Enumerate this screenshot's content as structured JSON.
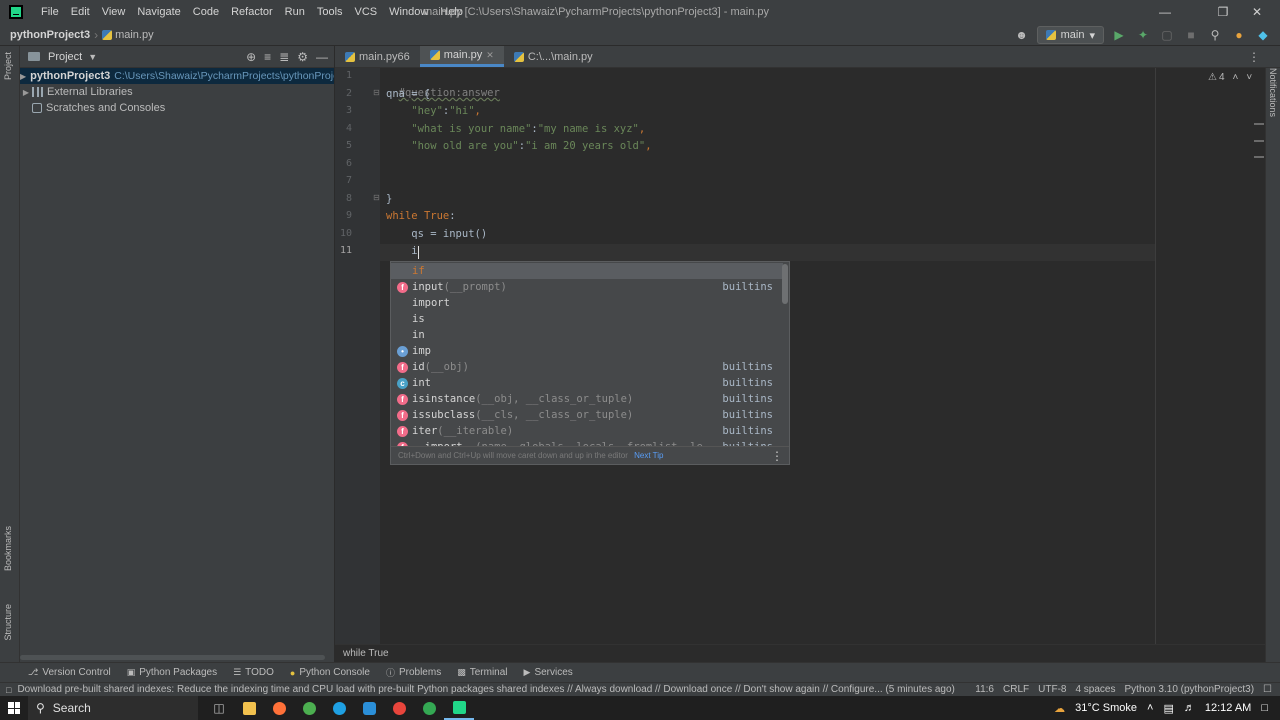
{
  "menu": [
    "File",
    "Edit",
    "View",
    "Navigate",
    "Code",
    "Refactor",
    "Run",
    "Tools",
    "VCS",
    "Window",
    "Help"
  ],
  "window_title": "main.py [C:\\Users\\Shawaiz\\PycharmProjects\\pythonProject3] - main.py",
  "nav": {
    "project": "pythonProject3",
    "file": "main.py",
    "run_config": "main"
  },
  "project_panel": {
    "title": "Project",
    "tree": [
      {
        "label": "pythonProject3",
        "path": "C:\\Users\\Shawaiz\\PycharmProjects\\pythonProject"
      },
      {
        "label": "External Libraries"
      },
      {
        "label": "Scratches and Consoles"
      }
    ]
  },
  "tabs": [
    "main.py66",
    "main.py",
    "C:\\...\\main.py"
  ],
  "line_numbers": [
    "1",
    "2",
    "3",
    "4",
    "5",
    "6",
    "7",
    "8",
    "9",
    "10",
    "11"
  ],
  "code": {
    "l1": "#question:answer",
    "l2a": "qna",
    "l2b": " = {",
    "l3a": "    \"hey\"",
    "l3b": ":",
    "l3c": "\"hi\"",
    "l3d": ",",
    "l4a": "    \"what is your name\"",
    "l4b": ":",
    "l4c": "\"my name is xyz\"",
    "l4d": ",",
    "l5a": "    \"how old are you\"",
    "l5b": ":",
    "l5c": "\"i am 20 years old\"",
    "l5d": ",",
    "l8": "}",
    "l9a": "while",
    "l9b": " ",
    "l9c": "True",
    "l9d": ":",
    "l10a": "    qs = ",
    "l10b": "input",
    "l10c": "()",
    "l11": "    i"
  },
  "inspection": {
    "warnings": "4"
  },
  "completion": {
    "items": [
      {
        "name": "if",
        "params": "",
        "source": "",
        "icon": "none"
      },
      {
        "name": "input",
        "params": "(__prompt)",
        "source": "builtins",
        "icon": "f"
      },
      {
        "name": "import",
        "params": "",
        "source": "",
        "icon": "none"
      },
      {
        "name": "is",
        "params": "",
        "source": "",
        "icon": "none"
      },
      {
        "name": "in",
        "params": "",
        "source": "",
        "icon": "none"
      },
      {
        "name": "imp",
        "params": "",
        "source": "",
        "icon": "m"
      },
      {
        "name": "id",
        "params": "(__obj)",
        "source": "builtins",
        "icon": "f"
      },
      {
        "name": "int",
        "params": "",
        "source": "builtins",
        "icon": "c"
      },
      {
        "name": "isinstance",
        "params": "(__obj, __class_or_tuple)",
        "source": "builtins",
        "icon": "f"
      },
      {
        "name": "issubclass",
        "params": "(__cls, __class_or_tuple)",
        "source": "builtins",
        "icon": "f"
      },
      {
        "name": "iter",
        "params": "(__iterable)",
        "source": "builtins",
        "icon": "f"
      },
      {
        "name": "__import__",
        "params": "(name, globals, locals, fromlist, le",
        "source": "builtins",
        "icon": "f"
      }
    ],
    "hint": "Ctrl+Down and Ctrl+Up will move caret down and up in the editor",
    "next_tip": "Next Tip"
  },
  "breadcrumb": "while True",
  "tool_windows": [
    "Version Control",
    "Python Packages",
    "TODO",
    "Python Console",
    "Problems",
    "Terminal",
    "Services"
  ],
  "status": {
    "message": "Download pre-built shared indexes: Reduce the indexing time and CPU load with pre-built Python packages shared indexes // Always download // Download once // Don't show again // Configure... (5 minutes ago)",
    "position": "11:6",
    "line_sep": "CRLF",
    "encoding": "UTF-8",
    "indent": "4 spaces",
    "interpreter": "Python 3.10 (pythonProject3)"
  },
  "side_labels": {
    "project": "Project",
    "bookmarks": "Bookmarks",
    "structure": "Structure",
    "notifications": "Notifications"
  },
  "taskbar": {
    "search": "Search",
    "weather": "31°C Smoke",
    "time": "12:12 AM"
  }
}
